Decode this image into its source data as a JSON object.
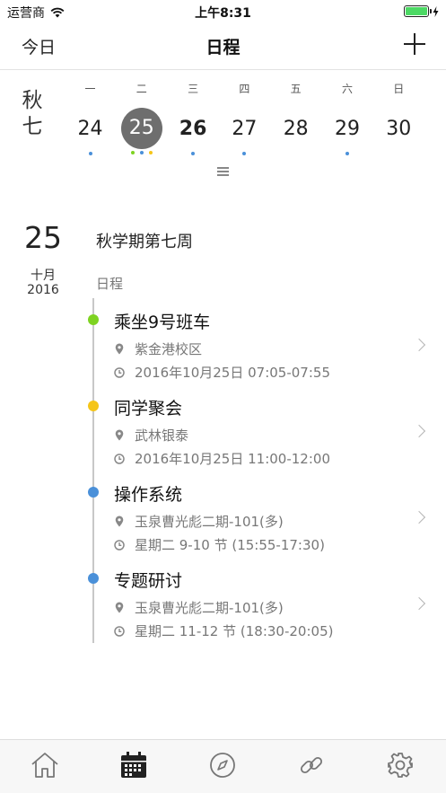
{
  "status_bar": {
    "carrier": "运营商",
    "time": "上午8:31",
    "battery_fill": 1.0
  },
  "nav": {
    "left": "今日",
    "title": "日程",
    "add_icon": "plus-icon"
  },
  "week_label": "秋七",
  "week_days": [
    {
      "name": "一",
      "num": "24",
      "dots": [
        "#4a90d9"
      ]
    },
    {
      "name": "二",
      "num": "25",
      "dots": [
        "#7ed321",
        "#4a90d9",
        "#f5c518"
      ],
      "selected": true
    },
    {
      "name": "三",
      "num": "26",
      "dots": [
        "#4a90d9"
      ],
      "bold": true
    },
    {
      "name": "四",
      "num": "27",
      "dots": [
        "#4a90d9"
      ]
    },
    {
      "name": "五",
      "num": "28",
      "dots": []
    },
    {
      "name": "六",
      "num": "29",
      "dots": [
        "#4a90d9"
      ]
    },
    {
      "name": "日",
      "num": "30",
      "dots": []
    }
  ],
  "day_header": {
    "day": "25",
    "month": "十月",
    "year": "2016",
    "week_title": "秋学期第七周",
    "section": "日程"
  },
  "events": [
    {
      "title": "乘坐9号班车",
      "location": "紫金港校区",
      "time": "2016年10月25日 07:05-07:55",
      "color": "#7ed321"
    },
    {
      "title": "同学聚会",
      "location": "武林银泰",
      "time": "2016年10月25日 11:00-12:00",
      "color": "#f5c518"
    },
    {
      "title": "操作系统",
      "location": "玉泉曹光彪二期-101(多)",
      "time": "星期二 9-10 节 (15:55-17:30)",
      "color": "#4a90d9"
    },
    {
      "title": "专题研讨",
      "location": "玉泉曹光彪二期-101(多)",
      "time": "星期二 11-12 节 (18:30-20:05)",
      "color": "#4a90d9"
    }
  ],
  "tabs": [
    {
      "icon": "home-icon"
    },
    {
      "icon": "calendar-icon",
      "active": true
    },
    {
      "icon": "compass-icon"
    },
    {
      "icon": "link-icon"
    },
    {
      "icon": "settings-icon"
    }
  ]
}
